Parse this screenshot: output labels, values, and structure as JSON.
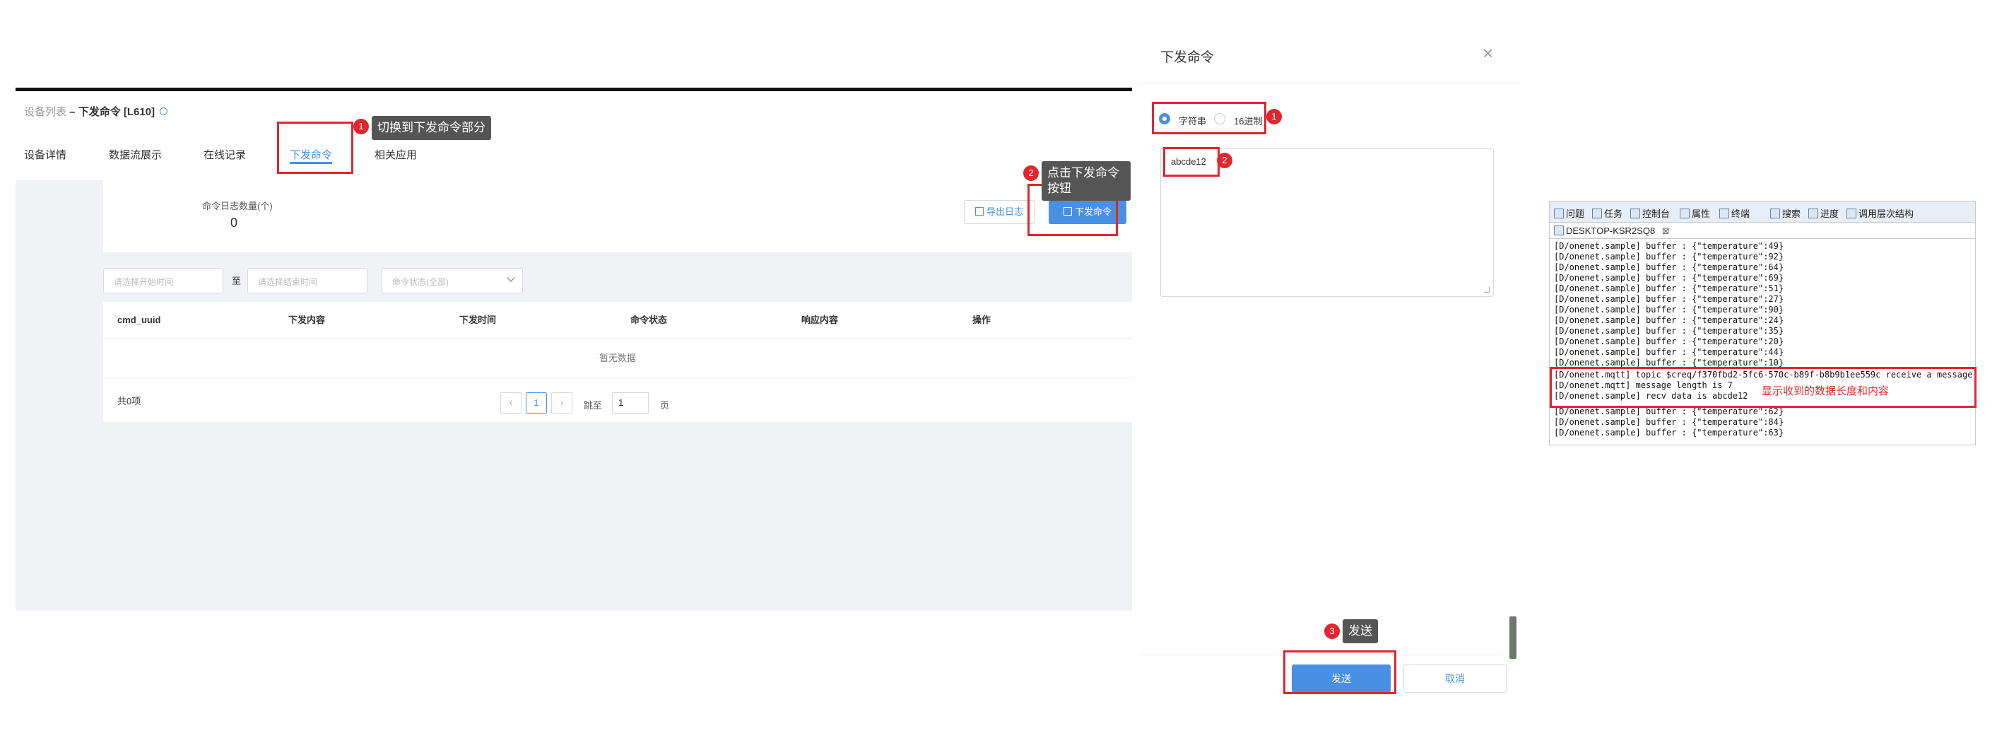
{
  "left": {
    "breadcrumb": {
      "parent": "设备列表",
      "separator": " – ",
      "current": "下发命令 [L610]"
    },
    "tabs": [
      {
        "label": "设备详情"
      },
      {
        "label": "数据流展示"
      },
      {
        "label": "在线记录"
      },
      {
        "label": "下发命令",
        "active": true
      },
      {
        "label": "相关应用"
      }
    ],
    "summary": {
      "label": "命令日志数量(个)",
      "value": "0"
    },
    "export_label": "导出日志",
    "send_command_label": "下发命令",
    "filters": {
      "start_placeholder": "请选择开始时间",
      "to": "至",
      "end_placeholder": "请选择结束时间",
      "status_placeholder": "命令状态(全部)"
    },
    "table": {
      "columns": [
        "cmd_uuid",
        "下发内容",
        "下发时间",
        "命令状态",
        "响应内容",
        "操作"
      ],
      "empty_text": "暂无数据",
      "total": "共0项",
      "pager": {
        "prev": "‹",
        "page": "1",
        "next": "›",
        "jump_label": "跳至",
        "jump_value": "1",
        "page_unit": "页"
      }
    }
  },
  "annotations": {
    "a1": {
      "num": "1",
      "text": "切换到下发命令部分"
    },
    "a2": {
      "num": "2",
      "text": "点击下发命令按钮"
    },
    "a3": {
      "num": "3",
      "text": "发送"
    },
    "d1": {
      "num": "1"
    },
    "d2": {
      "num": "2"
    },
    "console": "显示收到的数据长度和内容",
    "color": "#e0262f"
  },
  "dialog": {
    "title": "下发命令",
    "close": "×",
    "options": [
      {
        "label": "字符串",
        "checked": true
      },
      {
        "label": "16进制",
        "checked": false
      }
    ],
    "textarea_value": "abcde12",
    "send_label": "发送",
    "cancel_label": "取消"
  },
  "console": {
    "toolbar": [
      "问题",
      "任务",
      "控制台",
      "属性",
      "终端",
      "搜索",
      "进度",
      "调用层次结构"
    ],
    "tab": "DESKTOP-KSR2SQ8",
    "tab_close": "⊠",
    "lines": [
      "[D/onenet.sample] buffer : {\"temperature\":49}",
      "[D/onenet.sample] buffer : {\"temperature\":92}",
      "[D/onenet.sample] buffer : {\"temperature\":64}",
      "[D/onenet.sample] buffer : {\"temperature\":69}",
      "[D/onenet.sample] buffer : {\"temperature\":51}",
      "[D/onenet.sample] buffer : {\"temperature\":27}",
      "[D/onenet.sample] buffer : {\"temperature\":90}",
      "[D/onenet.sample] buffer : {\"temperature\":24}",
      "[D/onenet.sample] buffer : {\"temperature\":35}",
      "[D/onenet.sample] buffer : {\"temperature\":20}",
      "[D/onenet.sample] buffer : {\"temperature\":44}",
      "[D/onenet.sample] buffer : {\"temperature\":10}",
      "[D/onenet.mqtt] topic $creq/f370fbd2-5fc6-570c-b89f-b8b9b1ee559c receive a message",
      "[D/onenet.mqtt] message length is 7",
      "[D/onenet.sample] recv data is abcde12",
      "[D/onenet.sample] buffer : {\"temperature\":62}",
      "[D/onenet.sample] buffer : {\"temperature\":84}",
      "[D/onenet.sample] buffer : {\"temperature\":63}"
    ]
  }
}
